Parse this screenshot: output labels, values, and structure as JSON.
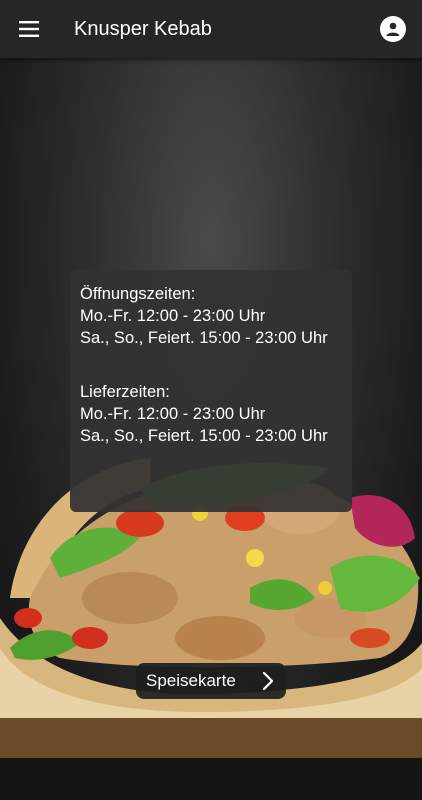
{
  "appbar": {
    "title": "Knusper Kebab",
    "menu_icon": "hamburger-menu-icon",
    "account_icon": "account-circle-icon"
  },
  "opening_hours": {
    "heading": "Öffnungszeiten:",
    "line1": "Mo.-Fr. 12:00 - 23:00 Uhr",
    "line2": "Sa., So., Feiert. 15:00 - 23:00 Uhr"
  },
  "delivery_hours": {
    "heading": "Lieferzeiten:",
    "line1": "Mo.-Fr. 12:00 - 23:00 Uhr",
    "line2": "Sa., So., Feiert. 15:00 - 23:00 Uhr"
  },
  "menu_button": {
    "label": "Speisekarte",
    "icon": "chevron-right-icon"
  },
  "colors": {
    "appbar": "#262626",
    "card": "#323232",
    "text": "#ffffff"
  }
}
